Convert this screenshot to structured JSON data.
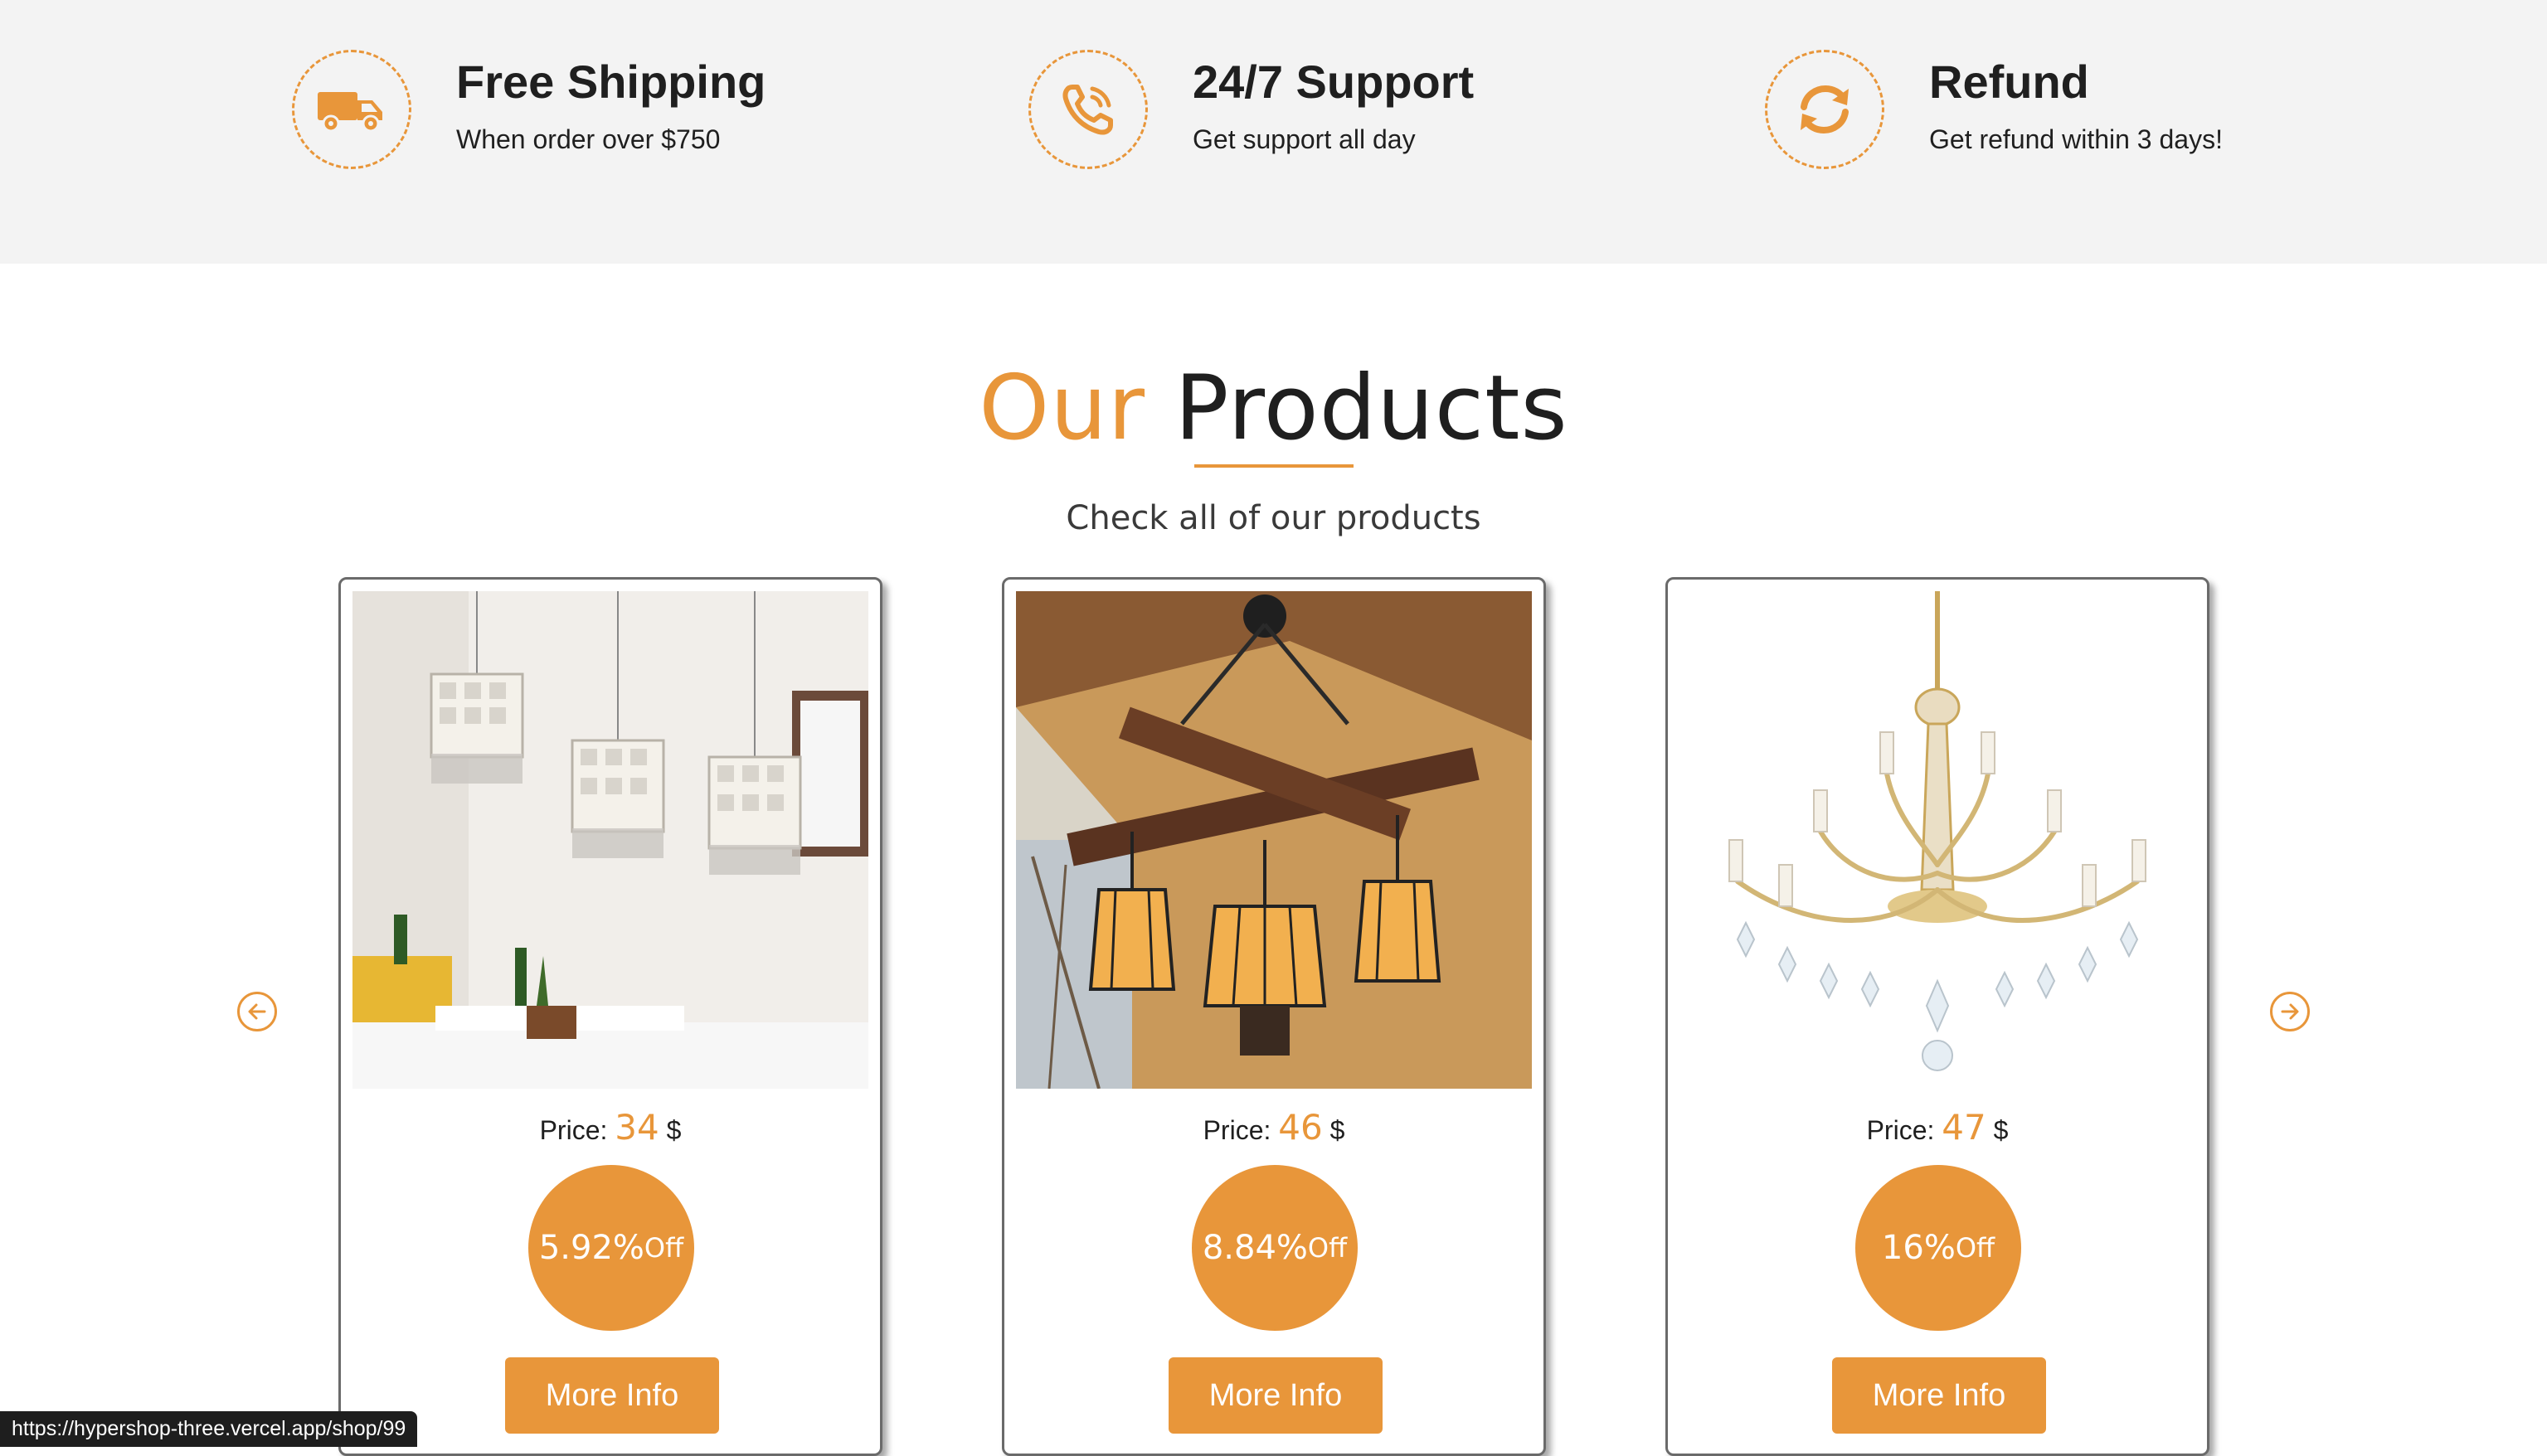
{
  "features": [
    {
      "icon": "truck-icon",
      "title": "Free Shipping",
      "subtitle": "When order over $750"
    },
    {
      "icon": "phone-icon",
      "title": "24/7 Support",
      "subtitle": "Get support all day"
    },
    {
      "icon": "refresh-icon",
      "title": "Refund",
      "subtitle": "Get refund within 3 days!"
    }
  ],
  "section": {
    "title_accent": "Our",
    "title_main": "Products",
    "subtitle": "Check all of our products"
  },
  "products": [
    {
      "image": "crystal-pendant-lights",
      "price_label": "Price:",
      "price": "34",
      "currency": "$",
      "discount": "5.92%",
      "off_label": "Off",
      "button": "More Info"
    },
    {
      "image": "rustic-wood-chandelier",
      "price_label": "Price:",
      "price": "46",
      "currency": "$",
      "discount": "8.84%",
      "off_label": "Off",
      "button": "More Info"
    },
    {
      "image": "crystal-gold-chandelier",
      "price_label": "Price:",
      "price": "47",
      "currency": "$",
      "discount": "16%",
      "off_label": "Off",
      "button": "More Info"
    }
  ],
  "carousel": {
    "prev_icon": "arrow-left-icon",
    "next_icon": "arrow-right-icon"
  },
  "status_url": "https://hypershop-three.vercel.app/shop/99",
  "colors": {
    "accent": "#e8963a",
    "band": "#f3f3f3",
    "text": "#1f1f1f"
  }
}
